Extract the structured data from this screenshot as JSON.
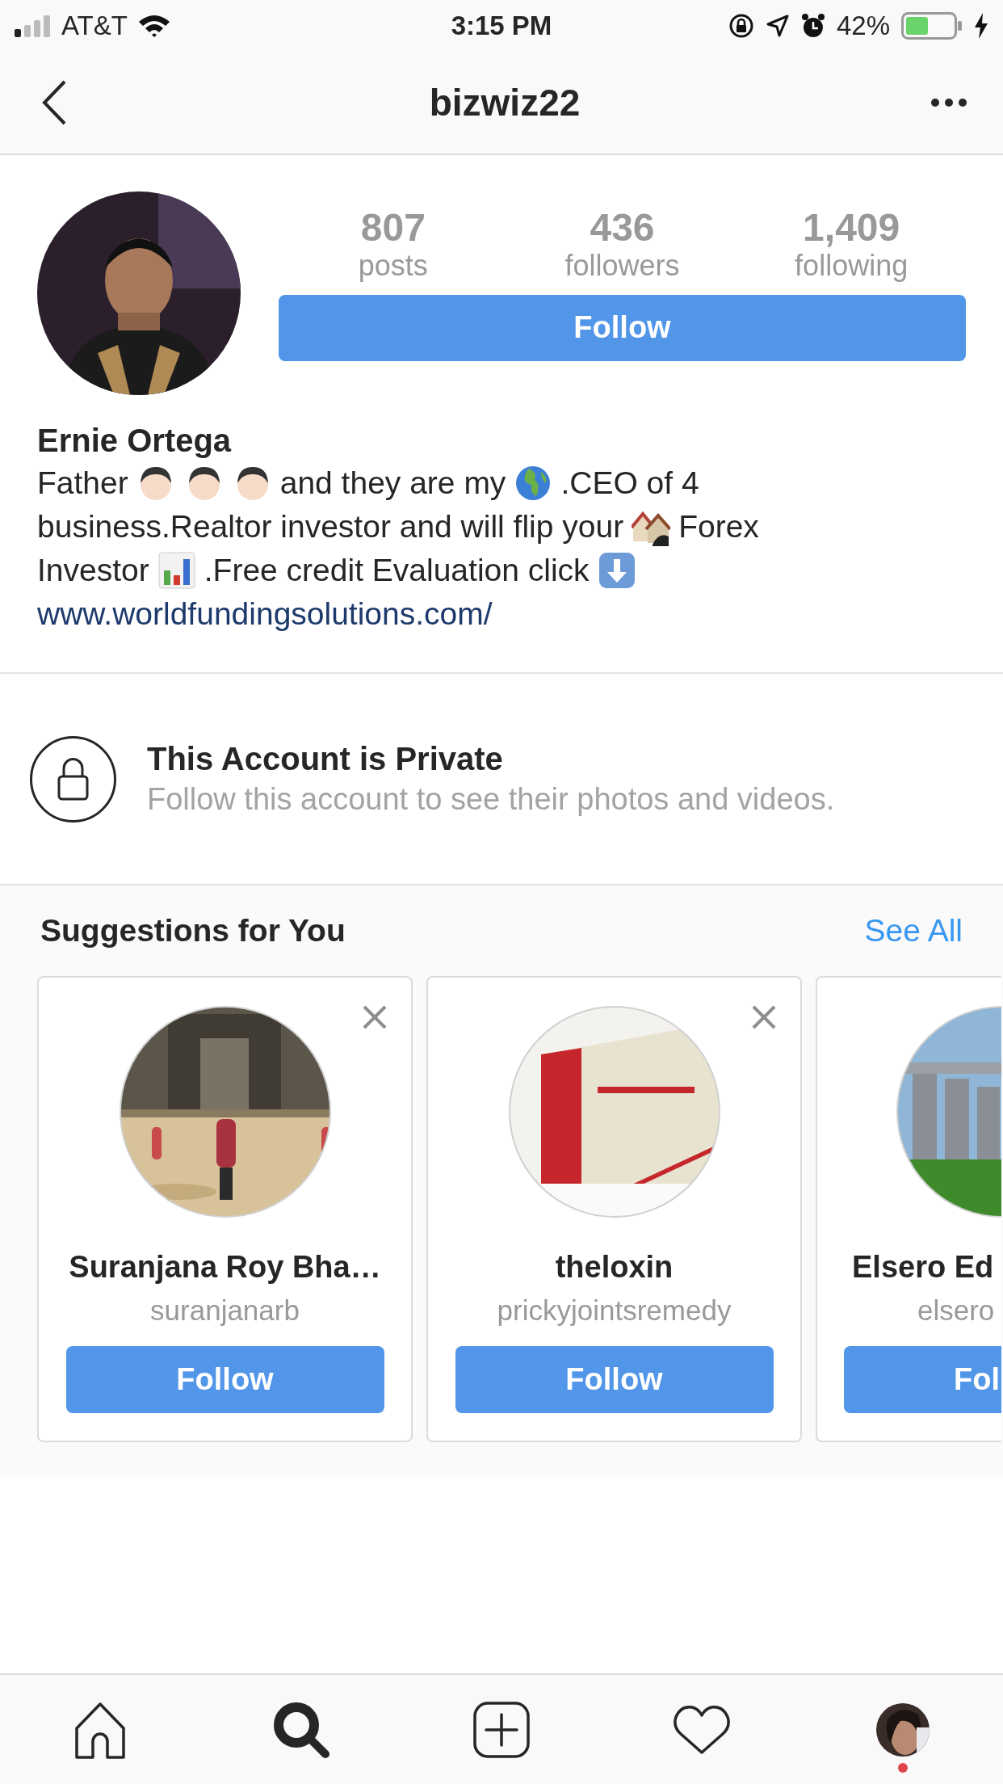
{
  "status_bar": {
    "carrier": "AT&T",
    "time": "3:15 PM",
    "battery": "42%"
  },
  "header": {
    "title": "bizwiz22"
  },
  "profile": {
    "stats": [
      {
        "value": "807",
        "label": "posts"
      },
      {
        "value": "436",
        "label": "followers"
      },
      {
        "value": "1,409",
        "label": "following"
      }
    ],
    "follow_button": "Follow",
    "name": "Ernie Ortega",
    "bio_lines": [
      [
        {
          "kind": "text",
          "text": "Father"
        },
        {
          "kind": "boy"
        },
        {
          "kind": "boy"
        },
        {
          "kind": "boy"
        },
        {
          "kind": "text",
          "text": "and they are my"
        },
        {
          "kind": "globe"
        },
        {
          "kind": "text",
          "text": ".CEO of 4"
        }
      ],
      [
        {
          "kind": "text",
          "text": "business.Realtor investor and will flip your"
        },
        {
          "kind": "houses"
        },
        {
          "kind": "text",
          "text": "Forex"
        }
      ],
      [
        {
          "kind": "text",
          "text": "Investor"
        },
        {
          "kind": "chart"
        },
        {
          "kind": "text",
          "text": ".Free credit Evaluation click"
        },
        {
          "kind": "down_arrow"
        }
      ]
    ],
    "link": "www.worldfundingsolutions.com/"
  },
  "private_notice": {
    "title": "This Account is Private",
    "subtitle": "Follow this account to see their photos and videos."
  },
  "suggestions": {
    "title": "Suggestions for You",
    "see_all": "See All",
    "cards": [
      {
        "kind": "full",
        "name": "Suranjana Roy Bha…",
        "username": "suranjanarb",
        "button": "Follow"
      },
      {
        "kind": "full",
        "name": "theloxin",
        "username": "prickyjointsremedy",
        "button": "Follow"
      },
      {
        "kind": "cut_off",
        "name": "Elsero Ed",
        "username": "elsero",
        "button": "Fol"
      }
    ]
  },
  "bottom_nav": {
    "tabs": [
      {
        "kind": "home",
        "selected": false
      },
      {
        "kind": "search",
        "selected": true
      },
      {
        "kind": "new_post",
        "selected": false
      },
      {
        "kind": "activity",
        "selected": false
      },
      {
        "kind": "profile",
        "selected": false,
        "notification": true
      }
    ]
  }
}
